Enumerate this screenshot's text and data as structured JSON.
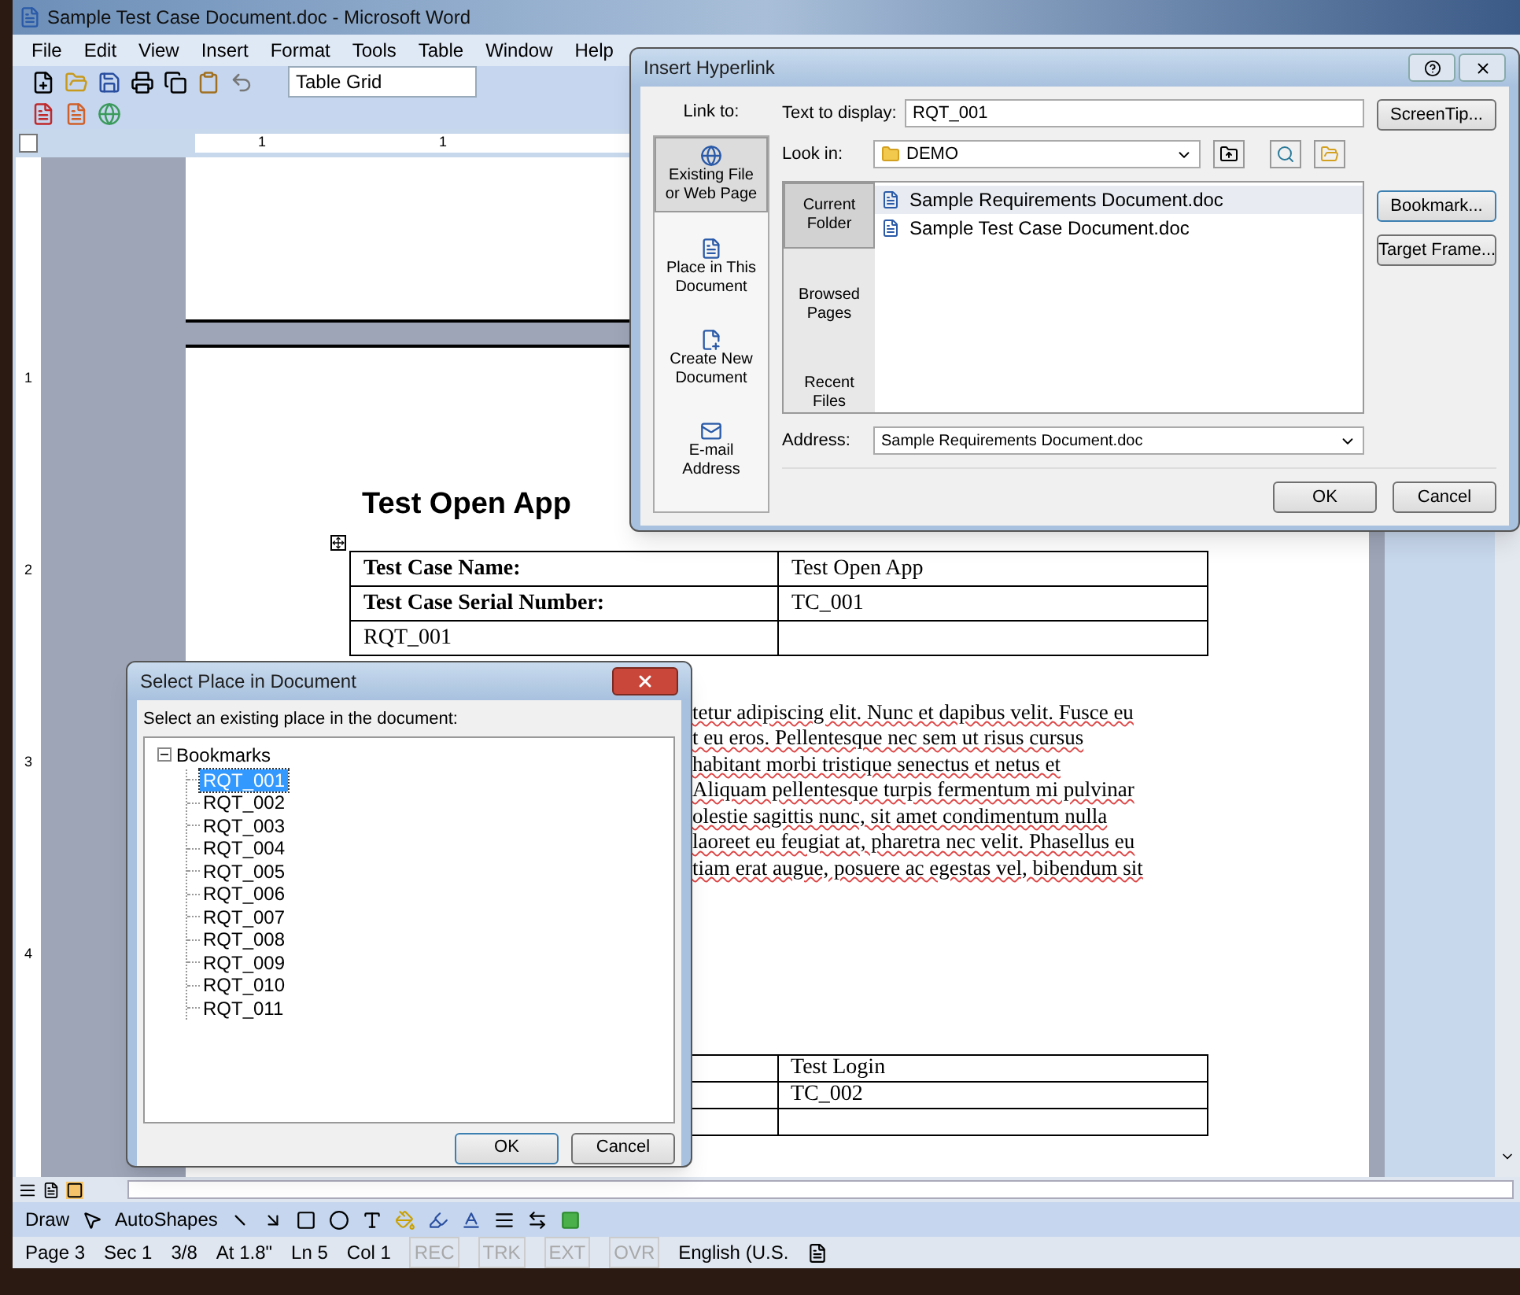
{
  "window": {
    "title": "Sample Test Case Document.doc - Microsoft Word"
  },
  "menu": [
    "File",
    "Edit",
    "View",
    "Insert",
    "Format",
    "Tools",
    "Table",
    "Window",
    "Help"
  ],
  "toolbar": {
    "style": "Table Grid"
  },
  "ruler": {
    "horizontal": [
      "1",
      "1"
    ],
    "vertical": [
      "1",
      "2",
      "3",
      "4"
    ]
  },
  "document": {
    "heading": "Test Open App",
    "table": [
      {
        "label": "Test Case Name:",
        "value": "Test Open App",
        "bold": true
      },
      {
        "label": "Test Case Serial Number:",
        "value": "TC_001",
        "bold": true
      },
      {
        "label": "RQT_001",
        "bold": false
      }
    ],
    "paragraph_lines": [
      "tetur adipiscing elit. Nunc et dapibus velit. Fusce eu",
      "t eu eros. Pellentesque nec sem ut risus cursus",
      "habitant morbi tristique senectus et netus et",
      "Aliquam pellentesque turpis fermentum mi pulvinar",
      "olestie sagittis nunc, sit amet condimentum nulla",
      "laoreet eu feugiat at, pharetra nec velit. Phasellus eu",
      "tiam erat augue, posuere ac egestas vel, bibendum sit"
    ],
    "table_2": [
      {
        "kind": "text",
        "column_2": "Test Login"
      },
      {
        "kind": "text",
        "column_2": "TC_002"
      },
      {
        "kind": "blank"
      }
    ]
  },
  "hyperlink_dialog": {
    "title": "Insert Hyperlink",
    "link_to_label": "Link to:",
    "link_to": [
      {
        "label": "Existing File or Web Page",
        "selected": true
      },
      {
        "label": "Place in This Document",
        "selected": false
      },
      {
        "label": "Create New Document",
        "selected": false
      },
      {
        "label": "E-mail Address",
        "selected": false
      }
    ],
    "text_to_display_label": "Text to display:",
    "text_to_display": "RQT_001",
    "look_in_label": "Look in:",
    "look_in": "DEMO",
    "nav": [
      {
        "label": "Current Folder",
        "selected": true
      },
      {
        "label": "Browsed Pages",
        "selected": false
      },
      {
        "label": "Recent Files",
        "selected": false
      }
    ],
    "files": [
      {
        "name": "Sample Requirements Document.doc",
        "selected": true
      },
      {
        "name": "Sample Test Case Document.doc",
        "selected": false
      }
    ],
    "address_label": "Address:",
    "address": "Sample Requirements Document.doc",
    "side_buttons": [
      "ScreenTip...",
      "Bookmark...",
      "Target Frame..."
    ],
    "ok": "OK",
    "cancel": "Cancel"
  },
  "bookmark_dialog": {
    "title": "Select Place in Document",
    "prompt": "Select an existing place in the document:",
    "tree": [
      {
        "label": "Bookmarks",
        "expanded": true,
        "children": [
          {
            "label": "RQT_001",
            "selected": true
          },
          {
            "label": "RQT_002",
            "selected": false
          },
          {
            "label": "RQT_003",
            "selected": false
          },
          {
            "label": "RQT_004",
            "selected": false
          },
          {
            "label": "RQT_005",
            "selected": false
          },
          {
            "label": "RQT_006",
            "selected": false
          },
          {
            "label": "RQT_007",
            "selected": false
          },
          {
            "label": "RQT_008",
            "selected": false
          },
          {
            "label": "RQT_009",
            "selected": false
          },
          {
            "label": "RQT_010",
            "selected": false
          },
          {
            "label": "RQT_011",
            "selected": false
          }
        ]
      }
    ],
    "ok": "OK",
    "cancel": "Cancel"
  },
  "drawing_toolbar": {
    "draw": "Draw",
    "autoshapes": "AutoShapes"
  },
  "status_bar": [
    {
      "text": "Page 3",
      "disabled": false
    },
    {
      "text": "Sec 1",
      "disabled": false
    },
    {
      "text": "3/8",
      "disabled": false
    },
    {
      "text": "At 1.8\"",
      "disabled": false
    },
    {
      "text": "Ln 5",
      "disabled": false
    },
    {
      "text": "Col 1",
      "disabled": false
    },
    {
      "text": "REC",
      "disabled": true
    },
    {
      "text": "TRK",
      "disabled": true
    },
    {
      "text": "EXT",
      "disabled": true
    },
    {
      "text": "OVR",
      "disabled": true
    },
    {
      "text": "English (U.S.",
      "disabled": false
    }
  ]
}
